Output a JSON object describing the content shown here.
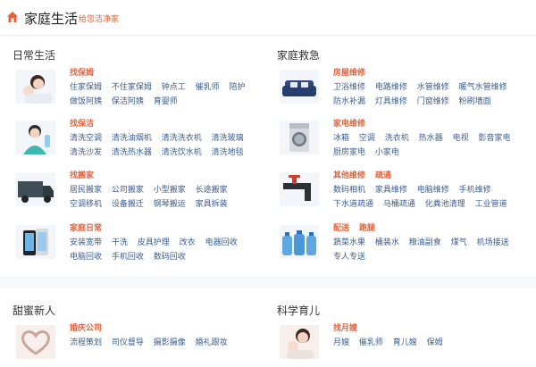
{
  "header": {
    "title": "家庭生活",
    "subtitle": "给您洁净家"
  },
  "sections": {
    "daily": {
      "title": "日常生活",
      "rows": [
        {
          "category": "找保姆",
          "links": [
            [
              "住家保姆",
              "不住家保姆",
              "钟点工",
              "催乳师",
              "陪护"
            ],
            [
              "做饭阿姨",
              "保洁阿姨",
              "育婴师"
            ]
          ]
        },
        {
          "category": "找保洁",
          "links": [
            [
              "清洗空调",
              "清洗油烟机",
              "清洗洗衣机",
              "清洗玻璃"
            ],
            [
              "清洗沙发",
              "清洗热水器",
              "清洗饮水机",
              "清洗地毯"
            ]
          ]
        },
        {
          "category": "找搬家",
          "links": [
            [
              "居民搬家",
              "公司搬家",
              "小型搬家",
              "长途搬家"
            ],
            [
              "空调移机",
              "设备搬迁",
              "钢琴搬运",
              "家具拆装"
            ]
          ]
        },
        {
          "category": "家庭日常",
          "links": [
            [
              "安装宽带",
              "干洗",
              "皮具护理",
              "改衣",
              "电器回收"
            ],
            [
              "电脑回收",
              "手机回收",
              "数码回收"
            ]
          ]
        }
      ]
    },
    "emergency": {
      "title": "家庭救急",
      "rows": [
        {
          "category": "房屋维修",
          "links": [
            [
              "卫浴维修",
              "电路维修",
              "水管维修",
              "暖气水管维修"
            ],
            [
              "防水补漏",
              "灯具维修",
              "门窗维修",
              "粉刷墙面"
            ]
          ]
        },
        {
          "category": "家电维修",
          "links": [
            [
              "冰箱",
              "空调",
              "洗衣机",
              "热水器",
              "电视",
              "影音家电"
            ],
            [
              "厨房家电",
              "小家电"
            ]
          ]
        },
        {
          "category": "其他维修",
          "category2": "疏通",
          "links": [
            [
              "数码相机",
              "家具维修",
              "电脑维修",
              "手机维修"
            ],
            [
              "下水道疏通",
              "马桶疏通",
              "化粪池清理",
              "工业管道"
            ]
          ]
        },
        {
          "category": "配送",
          "category2": "跑腿",
          "links": [
            [
              "蔬菜水果",
              "桶装水",
              "粮油副食",
              "煤气",
              "机场接送"
            ],
            [
              "专人专送"
            ]
          ]
        }
      ]
    },
    "newlyweds": {
      "title": "甜蜜新人",
      "rows": [
        {
          "category": "婚庆公司",
          "links": [
            [
              "流程策划",
              "司仪督导",
              "摄影摄像",
              "婚礼跟妆"
            ]
          ]
        }
      ]
    },
    "parenting": {
      "title": "科学育儿",
      "rows": [
        {
          "category": "找月嫂",
          "links": [
            [
              "月嫂",
              "催乳师",
              "育儿嫂",
              "保姆"
            ]
          ]
        }
      ]
    }
  },
  "colors": {
    "accent": "#e2623c",
    "link": "#3a5d8f",
    "heading": "#333333"
  }
}
